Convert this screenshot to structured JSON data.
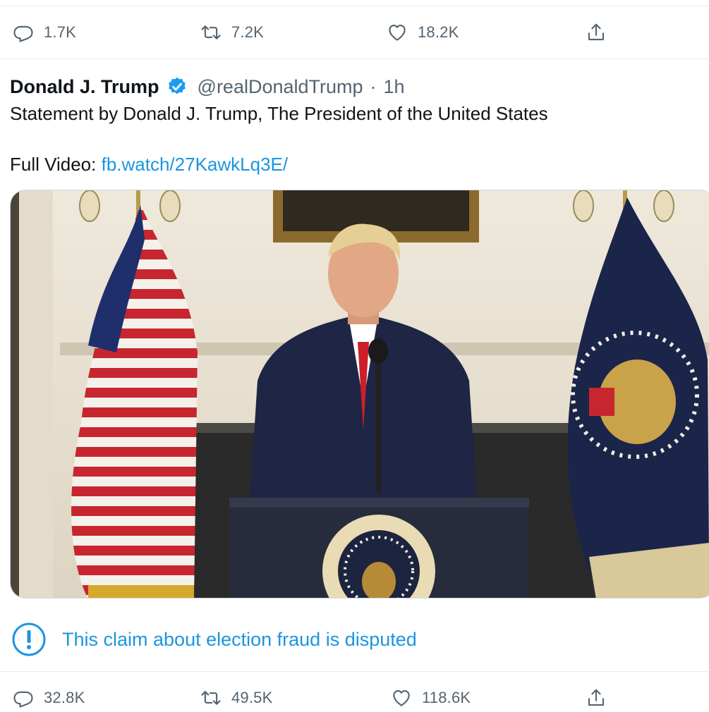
{
  "top_actions": {
    "replies": "1.7K",
    "retweets": "7.2K",
    "likes": "18.2K"
  },
  "tweet": {
    "author_name": "Donald J. Trump",
    "handle": "@realDonaldTrump",
    "separator": "·",
    "time": "1h",
    "text_line1": "Statement by Donald J. Trump, The President of the United States",
    "video_label": "Full Video:",
    "video_link": "fb.watch/27KawkLq3E/"
  },
  "notice": {
    "text": "This claim about election fraud is disputed"
  },
  "bottom_actions": {
    "replies": "32.8K",
    "retweets": "49.5K",
    "likes": "118.6K"
  },
  "colors": {
    "accent": "#1b95e0",
    "muted": "#536471",
    "text": "#0f1419",
    "divider": "#e6ecf0"
  },
  "icons": [
    "reply-icon",
    "retweet-icon",
    "like-icon",
    "share-icon",
    "verified-badge-icon",
    "info-icon"
  ]
}
